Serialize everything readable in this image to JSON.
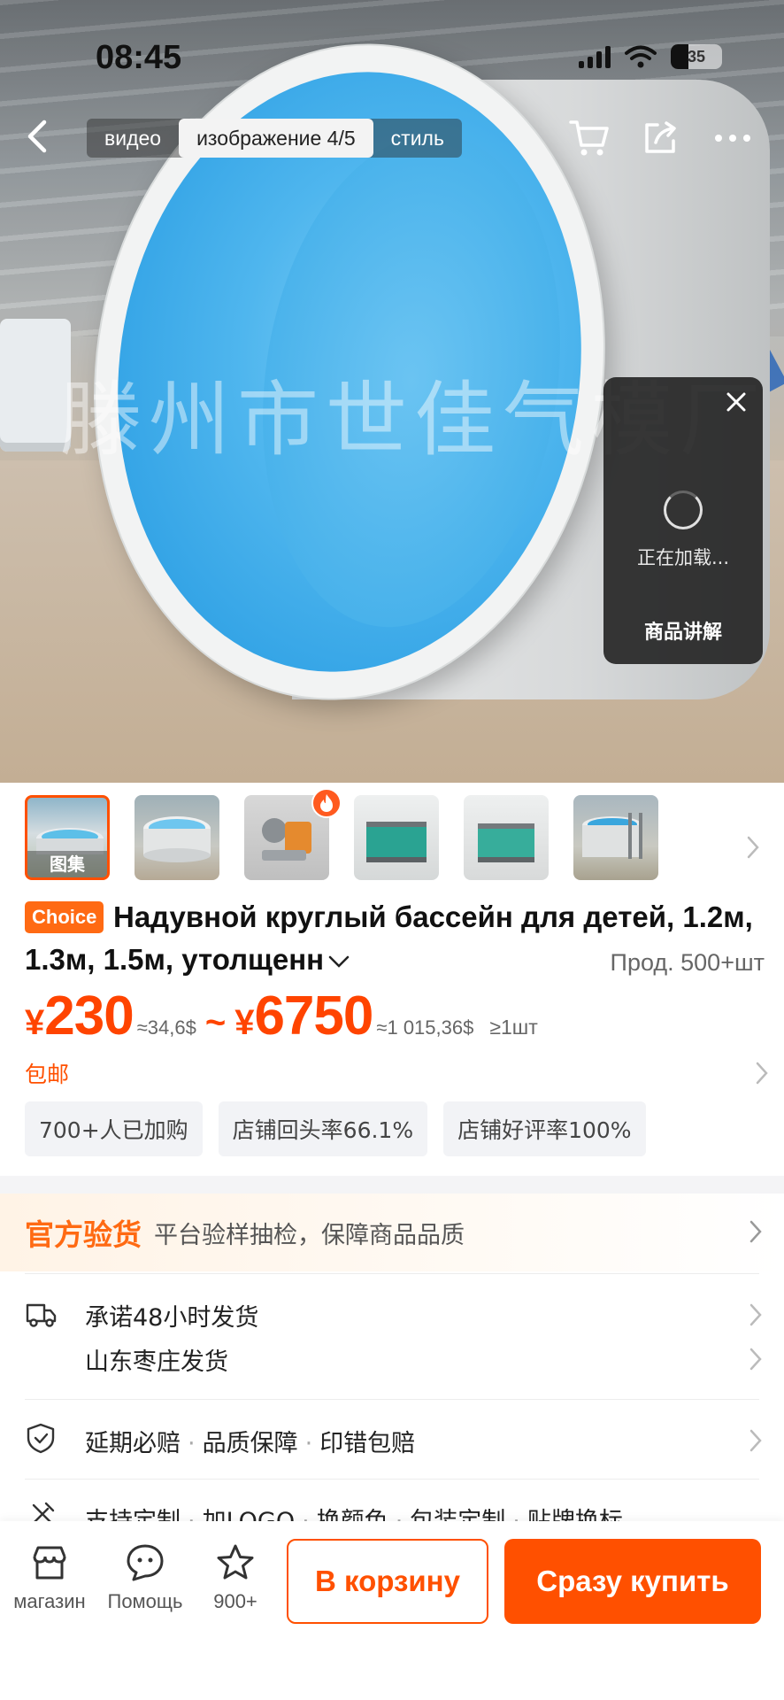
{
  "status_bar": {
    "time": "08:45",
    "battery": "35"
  },
  "nav": {
    "tabs": [
      {
        "label": "видео"
      },
      {
        "label": "изображение 4/5"
      },
      {
        "label": "стиль"
      }
    ]
  },
  "hero": {
    "watermark": "滕州市世佳气模厂"
  },
  "live_popup": {
    "loading": "正在加载...",
    "title": "商品讲解"
  },
  "thumbnails": {
    "first_label": "图集"
  },
  "product": {
    "badge": "Choice",
    "title": "Надувной круглый бассейн для детей, 1.2м, 1.3м, 1.5м, утолщенн",
    "sold": "Прод. 500+шт",
    "price": {
      "currency": "¥",
      "min": "230",
      "min_approx": "≈34,6$",
      "separator": "~",
      "max": "6750",
      "max_approx": "≈1 015,36$",
      "moq": "≥1шт"
    },
    "shipping": "包邮",
    "chips": [
      "700+人已加购",
      "店铺回头率66.1%",
      "店铺好评率100%"
    ]
  },
  "official": {
    "title": "官方验货",
    "desc": "平台验样抽检，保障商品品质"
  },
  "delivery": {
    "promise": "承诺48小时发货",
    "origin": "山东枣庄发货"
  },
  "guarantee": {
    "items": [
      "延期必赔",
      "品质保障",
      "印错包赔"
    ]
  },
  "customize": {
    "items": [
      "支持定制",
      "加LOGO",
      "换颜色",
      "包装定制",
      "贴牌换标"
    ]
  },
  "bottom_bar": {
    "store": "магазин",
    "help": "Помощь",
    "favorites": "900+",
    "cart": "В корзину",
    "buy": "Сразу купить"
  },
  "colors": {
    "accent": "#ff5000",
    "choice": "#ff6a13"
  }
}
